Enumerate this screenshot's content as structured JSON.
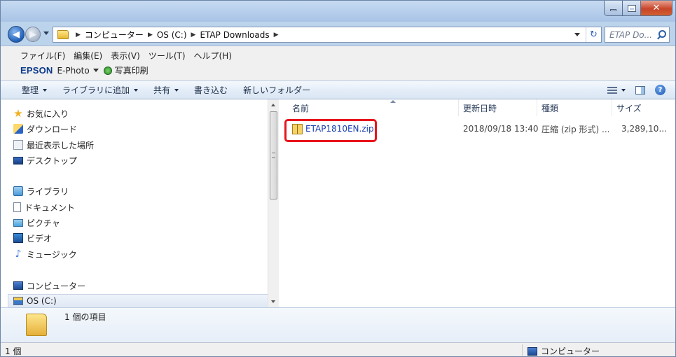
{
  "address": {
    "crumbs": [
      "コンピューター",
      "OS (C:)",
      "ETAP Downloads"
    ],
    "search_placeholder": "ETAP Do..."
  },
  "menu": {
    "items": [
      "ファイル(F)",
      "編集(E)",
      "表示(V)",
      "ツール(T)",
      "ヘルプ(H)"
    ]
  },
  "epson": {
    "logo": "EPSON",
    "app": "E-Photo",
    "print_label": "写真印刷"
  },
  "toolbar": {
    "organize": "整理",
    "add_to_library": "ライブラリに追加",
    "share": "共有",
    "burn": "書き込む",
    "new_folder": "新しいフォルダー"
  },
  "nav": {
    "favorites": "お気に入り",
    "downloads": "ダウンロード",
    "recent": "最近表示した場所",
    "desktop": "デスクトップ",
    "libraries": "ライブラリ",
    "documents": "ドキュメント",
    "pictures": "ピクチャ",
    "videos": "ビデオ",
    "music": "ミュージック",
    "computer": "コンピューター",
    "drive": "OS (C:)"
  },
  "columns": {
    "name": "名前",
    "date": "更新日時",
    "type": "種類",
    "size": "サイズ"
  },
  "files": [
    {
      "name": "ETAP1810EN.zip",
      "date": "2018/09/18 13:40",
      "type": "圧縮 (zip 形式) ...",
      "size": "3,289,10..."
    }
  ],
  "details": {
    "count": "1 個の項目"
  },
  "status": {
    "left": "1 個",
    "right": "コンピューター"
  },
  "colors": {
    "highlight": "#e8141c",
    "link": "#1a3fb0"
  }
}
